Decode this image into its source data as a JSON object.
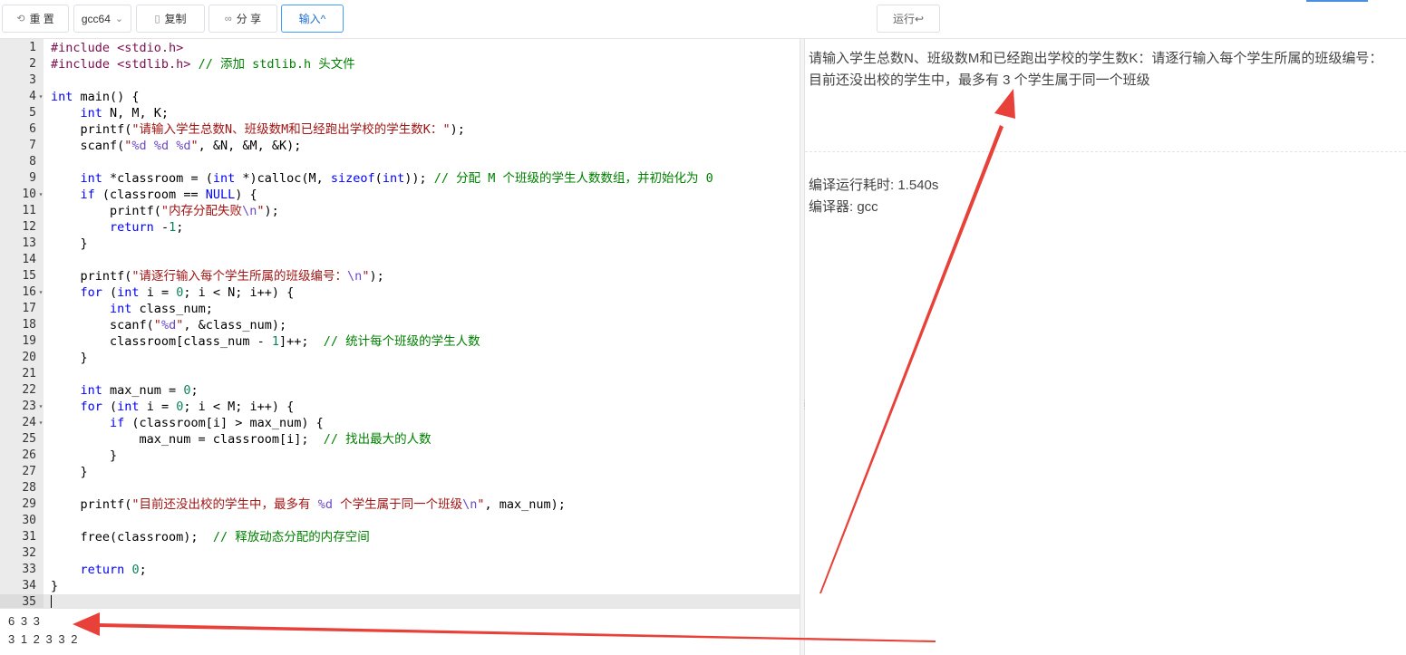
{
  "toolbar": {
    "reset_label": "重 置",
    "compiler_label": "gcc64",
    "copy_label": "复制",
    "share_label": "分 享",
    "input_label": "输入^",
    "run_label": "运行↩"
  },
  "editor": {
    "lines": [
      {
        "n": "1",
        "code": "#include <stdio.h>"
      },
      {
        "n": "2",
        "code": "#include <stdlib.h> // 添加 stdlib.h 头文件"
      },
      {
        "n": "3",
        "code": ""
      },
      {
        "n": "4",
        "code": "int main() {",
        "fold": true
      },
      {
        "n": "5",
        "code": "    int N, M, K;"
      },
      {
        "n": "6",
        "code": "    printf(\"请输入学生总数N、班级数M和已经跑出学校的学生数K：\");"
      },
      {
        "n": "7",
        "code": "    scanf(\"%d %d %d\", &N, &M, &K);"
      },
      {
        "n": "8",
        "code": ""
      },
      {
        "n": "9",
        "code": "    int *classroom = (int *)calloc(M, sizeof(int)); // 分配 M 个班级的学生人数数组，并初始化为 0"
      },
      {
        "n": "10",
        "code": "    if (classroom == NULL) {",
        "fold": true
      },
      {
        "n": "11",
        "code": "        printf(\"内存分配失败\\n\");"
      },
      {
        "n": "12",
        "code": "        return -1;"
      },
      {
        "n": "13",
        "code": "    }"
      },
      {
        "n": "14",
        "code": ""
      },
      {
        "n": "15",
        "code": "    printf(\"请逐行输入每个学生所属的班级编号：\\n\");"
      },
      {
        "n": "16",
        "code": "    for (int i = 0; i < N; i++) {",
        "fold": true
      },
      {
        "n": "17",
        "code": "        int class_num;"
      },
      {
        "n": "18",
        "code": "        scanf(\"%d\", &class_num);"
      },
      {
        "n": "19",
        "code": "        classroom[class_num - 1]++;  // 统计每个班级的学生人数"
      },
      {
        "n": "20",
        "code": "    }"
      },
      {
        "n": "21",
        "code": ""
      },
      {
        "n": "22",
        "code": "    int max_num = 0;"
      },
      {
        "n": "23",
        "code": "    for (int i = 0; i < M; i++) {",
        "fold": true
      },
      {
        "n": "24",
        "code": "        if (classroom[i] > max_num) {",
        "fold": true
      },
      {
        "n": "25",
        "code": "            max_num = classroom[i];  // 找出最大的人数"
      },
      {
        "n": "26",
        "code": "        }"
      },
      {
        "n": "27",
        "code": "    }"
      },
      {
        "n": "28",
        "code": ""
      },
      {
        "n": "29",
        "code": "    printf(\"目前还没出校的学生中，最多有 %d 个学生属于同一个班级\\n\", max_num);"
      },
      {
        "n": "30",
        "code": ""
      },
      {
        "n": "31",
        "code": "    free(classroom);  // 释放动态分配的内存空间"
      },
      {
        "n": "32",
        "code": ""
      },
      {
        "n": "33",
        "code": "    return 0;"
      },
      {
        "n": "34",
        "code": "}"
      },
      {
        "n": "35",
        "code": "",
        "active": true
      }
    ]
  },
  "stdin": {
    "line1": "6 3 3",
    "line2": "3 1 2 3 3 2"
  },
  "output": {
    "line1": "请输入学生总数N、班级数M和已经跑出学校的学生数K：请逐行输入每个学生所属的班级编号：",
    "line2": "目前还没出校的学生中，最多有 3 个学生属于同一个班级",
    "run_time": "编译运行耗时: 1.540s",
    "compiler": "编译器: gcc"
  },
  "colors": {
    "accent": "#409eff",
    "annotation_arrow": "#e8413a",
    "keyword": "#0000ff",
    "string": "#a31515",
    "comment": "#008000"
  },
  "icons": [
    "reset-icon",
    "chevron-down-icon",
    "copy-icon",
    "share-icon",
    "fold-arrow-icon",
    "splitter-grip-icon",
    "annotation-arrow"
  ]
}
